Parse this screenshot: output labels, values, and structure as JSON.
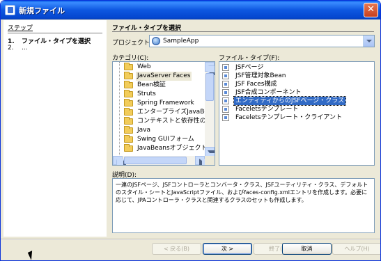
{
  "window": {
    "title": "新規ファイル",
    "close_glyph": "✕"
  },
  "steps": {
    "title": "ステップ",
    "items": [
      {
        "num": "1.",
        "label": "ファイル・タイプを選択",
        "current": true
      },
      {
        "num": "2.",
        "label": "...",
        "current": false
      }
    ]
  },
  "main": {
    "section_title": "ファイル・タイプを選択",
    "project_label": "プロジェクト(P):",
    "project_value": "SampleApp",
    "categories_label": "カテゴリ(C):",
    "file_types_label": "ファイル・タイプ(F):",
    "categories": [
      "Web",
      "JavaServer Faces",
      "Bean検証",
      "Struts",
      "Spring Framework",
      "エンタープライズJavaBeans",
      "コンテキストと依存性の注入",
      "Java",
      "Swing GUIフォーム",
      "JavaBeansオブジェクト"
    ],
    "selected_category_index": 1,
    "file_types": [
      "JSFページ",
      "JSF管理対象Bean",
      "JSF Faces構成",
      "JSF合成コンポーネント",
      "エンティティからのJSFページ・クラス",
      "Faceletsテンプレート",
      "Faceletsテンプレート・クライアント"
    ],
    "selected_file_type_index": 4,
    "description_label": "説明(D):",
    "description": "一連のJSFページ、JSFコントローラとコンバータ・クラス、JSFユーティリティ・クラス、デフォルトのスタイル・シートとJavaScriptファイル、およびfaces-config.xmlエントリを作成します。必要に応じて、JPAコントローラ・クラスと関連するクラスのセットも作成します。"
  },
  "buttons": {
    "back": "< 戻る(B)",
    "next": "次 >",
    "finish": "終了(F)",
    "cancel": "取消",
    "help": "ヘルプ(H)"
  }
}
